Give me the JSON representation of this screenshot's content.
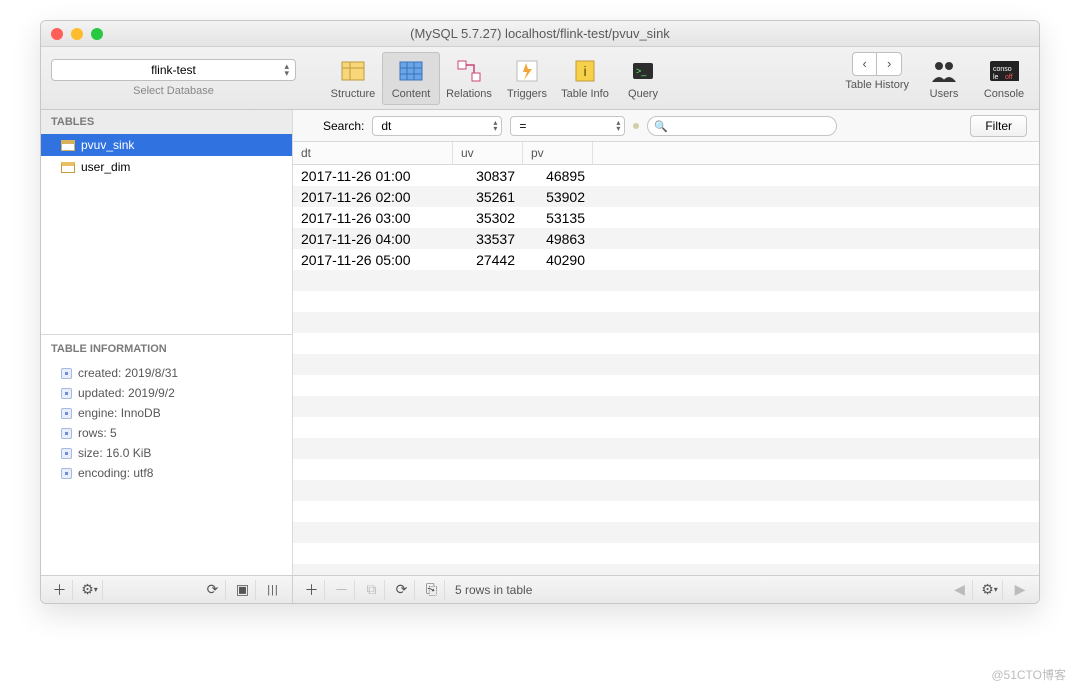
{
  "window": {
    "title": "(MySQL 5.7.27) localhost/flink-test/pvuv_sink"
  },
  "db_selector": {
    "value": "flink-test",
    "caption": "Select Database"
  },
  "toolbar": {
    "structure": "Structure",
    "content": "Content",
    "relations": "Relations",
    "triggers": "Triggers",
    "table_info": "Table Info",
    "query": "Query",
    "table_history": "Table History",
    "users": "Users",
    "console": "Console"
  },
  "sidebar": {
    "tables_header": "TABLES",
    "tables": [
      {
        "name": "pvuv_sink",
        "selected": true
      },
      {
        "name": "user_dim",
        "selected": false
      }
    ],
    "info_header": "TABLE INFORMATION",
    "info": {
      "created": "created: 2019/8/31",
      "updated": "updated: 2019/9/2",
      "engine": "engine: InnoDB",
      "rows": "rows: 5",
      "size": "size: 16.0 KiB",
      "encoding": "encoding: utf8"
    }
  },
  "search": {
    "label": "Search:",
    "field": "dt",
    "op": "=",
    "value": "",
    "placeholder": "",
    "filter_btn": "Filter"
  },
  "columns": {
    "dt": "dt",
    "uv": "uv",
    "pv": "pv"
  },
  "rows": [
    {
      "dt": "2017-11-26 01:00",
      "uv": "30837",
      "pv": "46895"
    },
    {
      "dt": "2017-11-26 02:00",
      "uv": "35261",
      "pv": "53902"
    },
    {
      "dt": "2017-11-26 03:00",
      "uv": "35302",
      "pv": "53135"
    },
    {
      "dt": "2017-11-26 04:00",
      "uv": "33537",
      "pv": "49863"
    },
    {
      "dt": "2017-11-26 05:00",
      "uv": "27442",
      "pv": "40290"
    }
  ],
  "status_bar": {
    "rows_text": "5 rows in table"
  },
  "watermark": "@51CTO博客"
}
